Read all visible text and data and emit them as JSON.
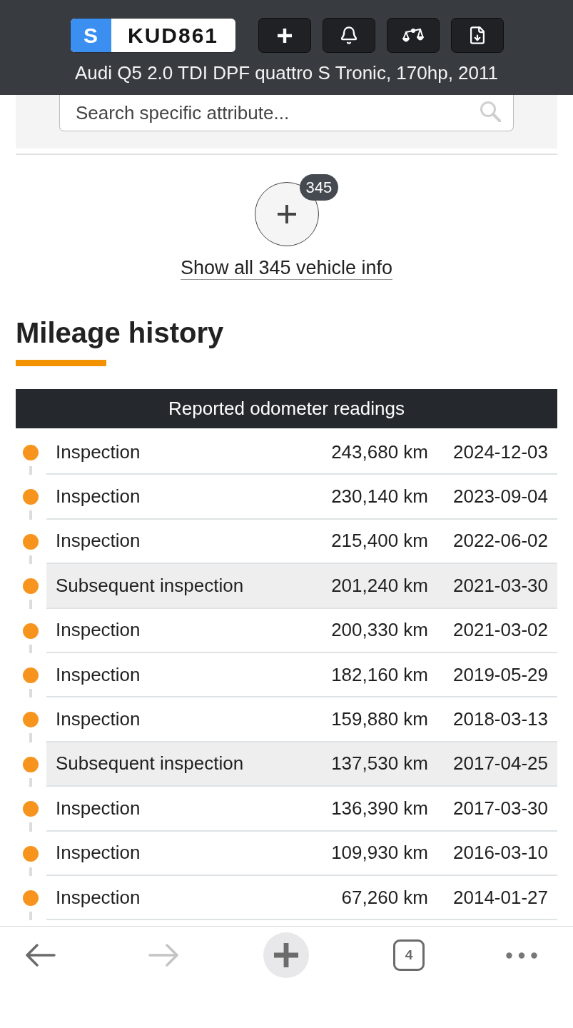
{
  "header": {
    "plate": {
      "country": "S",
      "number": "KUD861"
    },
    "actions": [
      {
        "kind": "add"
      },
      {
        "kind": "notify"
      },
      {
        "kind": "compare"
      },
      {
        "kind": "export"
      }
    ],
    "title": "Audi Q5 2.0 TDI DPF quattro S Tronic, 170hp, 2011"
  },
  "search": {
    "placeholder": "Search specific attribute..."
  },
  "show_all": {
    "badge": "345",
    "link": "Show all 345 vehicle info"
  },
  "mileage": {
    "title": "Mileage history",
    "table_title": "Reported odometer readings",
    "rows": [
      {
        "event": "Inspection",
        "mileage": "243,680 km",
        "date": "2024-12-03",
        "highlighted": false
      },
      {
        "event": "Inspection",
        "mileage": "230,140 km",
        "date": "2023-09-04",
        "highlighted": false
      },
      {
        "event": "Inspection",
        "mileage": "215,400 km",
        "date": "2022-06-02",
        "highlighted": false
      },
      {
        "event": "Subsequent inspection",
        "mileage": "201,240 km",
        "date": "2021-03-30",
        "highlighted": true
      },
      {
        "event": "Inspection",
        "mileage": "200,330 km",
        "date": "2021-03-02",
        "highlighted": false
      },
      {
        "event": "Inspection",
        "mileage": "182,160 km",
        "date": "2019-05-29",
        "highlighted": false
      },
      {
        "event": "Inspection",
        "mileage": "159,880 km",
        "date": "2018-03-13",
        "highlighted": false
      },
      {
        "event": "Subsequent inspection",
        "mileage": "137,530 km",
        "date": "2017-04-25",
        "highlighted": true
      },
      {
        "event": "Inspection",
        "mileage": "136,390 km",
        "date": "2017-03-30",
        "highlighted": false
      },
      {
        "event": "Inspection",
        "mileage": "109,930 km",
        "date": "2016-03-10",
        "highlighted": false
      },
      {
        "event": "Inspection",
        "mileage": "67,260 km",
        "date": "2014-01-27",
        "highlighted": false
      }
    ]
  },
  "bottom_nav": {
    "back": {
      "disabled": false
    },
    "forward": {
      "disabled": true
    },
    "tab_count": "4"
  }
}
